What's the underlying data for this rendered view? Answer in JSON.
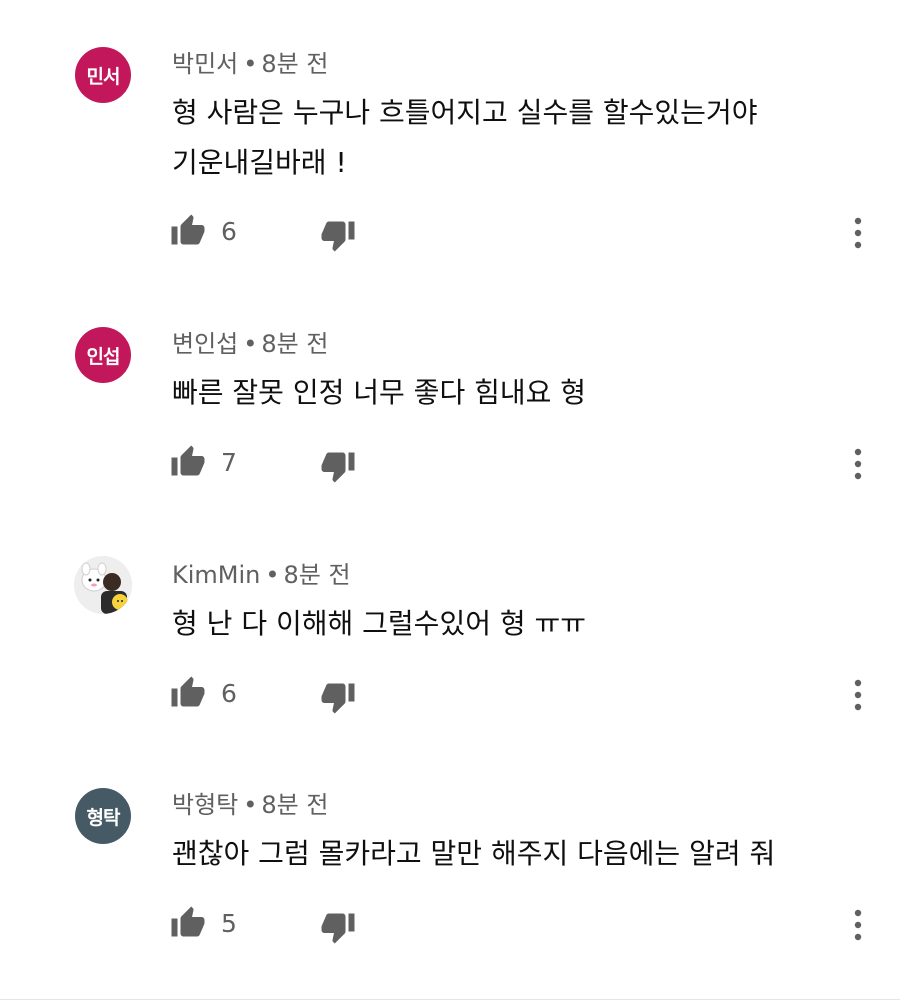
{
  "comments": [
    {
      "avatar_text": "민서",
      "avatar_color": "#c2185b",
      "author": "박민서",
      "separator": "•",
      "time": "8분 전",
      "text": "형 사람은 누구나 흐틀어지고 실수를 할수있는거야\n기운내길바래 !",
      "likes": "6"
    },
    {
      "avatar_text": "인섭",
      "avatar_color": "#c2185b",
      "author": "변인섭",
      "separator": "•",
      "time": "8분 전",
      "text": "빠른 잘못 인정 너무 좋다 힘내요 형",
      "likes": "7"
    },
    {
      "avatar_text": "",
      "avatar_color": "#f1f1f1",
      "author": "KimMin",
      "separator": "•",
      "time": "8분 전",
      "text": "형 난 다 이해해 그럴수있어 형 ㅠㅠ",
      "likes": "6"
    },
    {
      "avatar_text": "형탁",
      "avatar_color": "#455a64",
      "author": "박형탁",
      "separator": "•",
      "time": "8분 전",
      "text": "괜찮아 그럼 몰카라고 말만 해주지 다음에는 알려 줘",
      "likes": "5"
    }
  ],
  "icons": {
    "like": "thumbs-up-icon",
    "dislike": "thumbs-down-icon",
    "more": "more-vertical-icon"
  },
  "colors": {
    "text_primary": "#0f0f0f",
    "text_secondary": "#606060",
    "icon": "#606060"
  }
}
